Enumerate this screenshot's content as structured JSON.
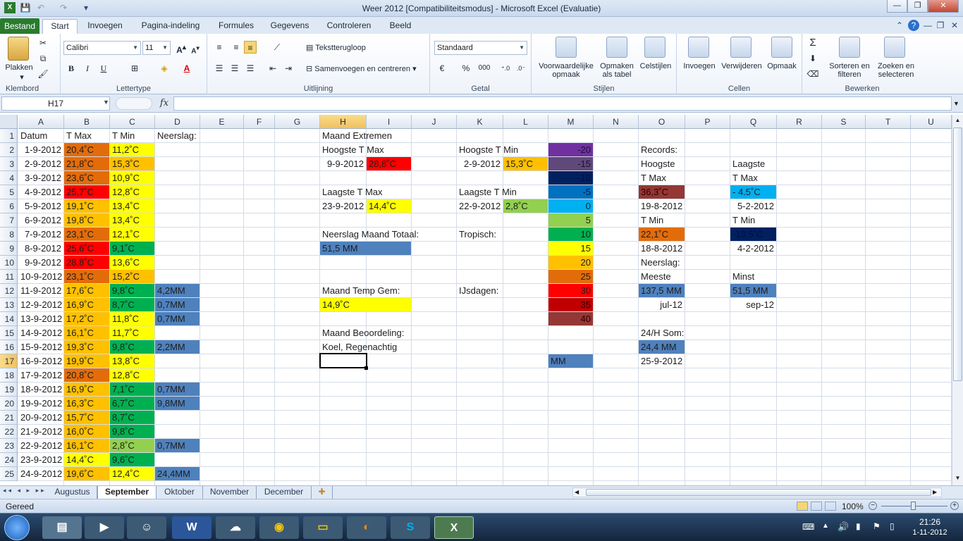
{
  "window": {
    "title": "Weer 2012  [Compatibiliteitsmodus]  -  Microsoft Excel (Evaluatie)",
    "minimize": "—",
    "restore": "❐",
    "close": "✕"
  },
  "ribbon_tabs": [
    "Bestand",
    "Start",
    "Invoegen",
    "Pagina-indeling",
    "Formules",
    "Gegevens",
    "Controleren",
    "Beeld"
  ],
  "ribbon": {
    "klembord": {
      "label": "Klembord",
      "plakken": "Plakken"
    },
    "lettertype": {
      "label": "Lettertype",
      "font": "Calibri",
      "size": "11",
      "bold": "B",
      "italic": "I",
      "underline": "U"
    },
    "uitlijning": {
      "label": "Uitlijning",
      "wrap": "Tekstterugloop",
      "merge": "Samenvoegen en centreren"
    },
    "getal": {
      "label": "Getal",
      "format": "Standaard",
      "percent": "%",
      "thousands": "000"
    },
    "stijlen": {
      "label": "Stijlen",
      "conditional": "Voorwaardelijke opmaak",
      "as_table": "Opmaken als tabel",
      "cell_styles": "Celstijlen"
    },
    "cellen": {
      "label": "Cellen",
      "insert": "Invoegen",
      "delete": "Verwijderen",
      "format": "Opmaak"
    },
    "bewerken": {
      "label": "Bewerken",
      "sort": "Sorteren en filteren",
      "find": "Zoeken en selecteren",
      "sigma": "Σ"
    }
  },
  "formula_bar": {
    "name_box": "H17",
    "fx": "fx",
    "value": ""
  },
  "columns": [
    "A",
    "B",
    "C",
    "D",
    "E",
    "F",
    "G",
    "H",
    "I",
    "J",
    "K",
    "L",
    "M",
    "N",
    "O",
    "P",
    "Q",
    "R",
    "S",
    "T",
    "U"
  ],
  "rows": [
    "1",
    "2",
    "3",
    "4",
    "5",
    "6",
    "7",
    "8",
    "9",
    "10",
    "11",
    "12",
    "13",
    "14",
    "15",
    "16",
    "17",
    "18",
    "19",
    "20",
    "21",
    "22",
    "23",
    "24",
    "25"
  ],
  "colors": {
    "orange_dark": "#e36c0a",
    "orange": "#ffc000",
    "red": "#ff0000",
    "yellow": "#ffff00",
    "green": "#00b050",
    "lightgreen": "#92d050",
    "blue": "#4f81bd",
    "skyblue": "#00b0f0",
    "navy": "#002060",
    "purple": "#7030a0",
    "darkred": "#c00000",
    "maroon": "#953734"
  },
  "cells": [
    {
      "r": 1,
      "c": "A",
      "v": "Datum"
    },
    {
      "r": 1,
      "c": "B",
      "v": "T Max"
    },
    {
      "r": 1,
      "c": "C",
      "v": "T Min"
    },
    {
      "r": 1,
      "c": "D",
      "v": "Neerslag:"
    },
    {
      "r": 2,
      "c": "A",
      "v": "1-9-2012",
      "a": "r"
    },
    {
      "r": 2,
      "c": "B",
      "v": "20,4˚C",
      "bg": "#e36c0a"
    },
    {
      "r": 2,
      "c": "C",
      "v": "11,2˚C",
      "bg": "#ffff00"
    },
    {
      "r": 3,
      "c": "A",
      "v": "2-9-2012",
      "a": "r"
    },
    {
      "r": 3,
      "c": "B",
      "v": "21,8˚C",
      "bg": "#e36c0a"
    },
    {
      "r": 3,
      "c": "C",
      "v": "15,3˚C",
      "bg": "#ffc000"
    },
    {
      "r": 4,
      "c": "A",
      "v": "3-9-2012",
      "a": "r"
    },
    {
      "r": 4,
      "c": "B",
      "v": "23,6˚C",
      "bg": "#e36c0a"
    },
    {
      "r": 4,
      "c": "C",
      "v": "10,9˚C",
      "bg": "#ffff00"
    },
    {
      "r": 5,
      "c": "A",
      "v": "4-9-2012",
      "a": "r"
    },
    {
      "r": 5,
      "c": "B",
      "v": "25,7˚C",
      "bg": "#ff0000"
    },
    {
      "r": 5,
      "c": "C",
      "v": "12,8˚C",
      "bg": "#ffff00"
    },
    {
      "r": 6,
      "c": "A",
      "v": "5-9-2012",
      "a": "r"
    },
    {
      "r": 6,
      "c": "B",
      "v": "19,1˚C",
      "bg": "#ffc000"
    },
    {
      "r": 6,
      "c": "C",
      "v": "13,4˚C",
      "bg": "#ffff00"
    },
    {
      "r": 7,
      "c": "A",
      "v": "6-9-2012",
      "a": "r"
    },
    {
      "r": 7,
      "c": "B",
      "v": "19,8˚C",
      "bg": "#ffc000"
    },
    {
      "r": 7,
      "c": "C",
      "v": "13,4˚C",
      "bg": "#ffff00"
    },
    {
      "r": 8,
      "c": "A",
      "v": "7-9-2012",
      "a": "r"
    },
    {
      "r": 8,
      "c": "B",
      "v": "23,1˚C",
      "bg": "#e36c0a"
    },
    {
      "r": 8,
      "c": "C",
      "v": "12,1˚C",
      "bg": "#ffff00"
    },
    {
      "r": 9,
      "c": "A",
      "v": "8-9-2012",
      "a": "r"
    },
    {
      "r": 9,
      "c": "B",
      "v": "25,6˚C",
      "bg": "#ff0000"
    },
    {
      "r": 9,
      "c": "C",
      "v": "9,1˚C",
      "bg": "#00b050"
    },
    {
      "r": 10,
      "c": "A",
      "v": "9-9-2012",
      "a": "r"
    },
    {
      "r": 10,
      "c": "B",
      "v": "28,8˚C",
      "bg": "#ff0000"
    },
    {
      "r": 10,
      "c": "C",
      "v": "13,6˚C",
      "bg": "#ffff00"
    },
    {
      "r": 11,
      "c": "A",
      "v": "10-9-2012",
      "a": "r"
    },
    {
      "r": 11,
      "c": "B",
      "v": "23,1˚C",
      "bg": "#e36c0a"
    },
    {
      "r": 11,
      "c": "C",
      "v": "15,2˚C",
      "bg": "#ffc000"
    },
    {
      "r": 12,
      "c": "A",
      "v": "11-9-2012",
      "a": "r"
    },
    {
      "r": 12,
      "c": "B",
      "v": "17,6˚C",
      "bg": "#ffc000"
    },
    {
      "r": 12,
      "c": "C",
      "v": "9,8˚C",
      "bg": "#00b050"
    },
    {
      "r": 12,
      "c": "D",
      "v": "4,2MM",
      "bg": "#4f81bd"
    },
    {
      "r": 13,
      "c": "A",
      "v": "12-9-2012",
      "a": "r"
    },
    {
      "r": 13,
      "c": "B",
      "v": "16,9˚C",
      "bg": "#ffc000"
    },
    {
      "r": 13,
      "c": "C",
      "v": "8,7˚C",
      "bg": "#00b050"
    },
    {
      "r": 13,
      "c": "D",
      "v": "0,7MM",
      "bg": "#4f81bd"
    },
    {
      "r": 14,
      "c": "A",
      "v": "13-9-2012",
      "a": "r"
    },
    {
      "r": 14,
      "c": "B",
      "v": "17,2˚C",
      "bg": "#ffc000"
    },
    {
      "r": 14,
      "c": "C",
      "v": "11,8˚C",
      "bg": "#ffff00"
    },
    {
      "r": 14,
      "c": "D",
      "v": "0,7MM",
      "bg": "#4f81bd"
    },
    {
      "r": 15,
      "c": "A",
      "v": "14-9-2012",
      "a": "r"
    },
    {
      "r": 15,
      "c": "B",
      "v": "16,1˚C",
      "bg": "#ffc000"
    },
    {
      "r": 15,
      "c": "C",
      "v": "11,7˚C",
      "bg": "#ffff00"
    },
    {
      "r": 16,
      "c": "A",
      "v": "15-9-2012",
      "a": "r"
    },
    {
      "r": 16,
      "c": "B",
      "v": "19,3˚C",
      "bg": "#ffc000"
    },
    {
      "r": 16,
      "c": "C",
      "v": "9,8˚C",
      "bg": "#00b050"
    },
    {
      "r": 16,
      "c": "D",
      "v": "2,2MM",
      "bg": "#4f81bd"
    },
    {
      "r": 17,
      "c": "A",
      "v": "16-9-2012",
      "a": "r"
    },
    {
      "r": 17,
      "c": "B",
      "v": "19,9˚C",
      "bg": "#ffc000"
    },
    {
      "r": 17,
      "c": "C",
      "v": "13,8˚C",
      "bg": "#ffff00"
    },
    {
      "r": 18,
      "c": "A",
      "v": "17-9-2012",
      "a": "r"
    },
    {
      "r": 18,
      "c": "B",
      "v": "20,8˚C",
      "bg": "#e36c0a"
    },
    {
      "r": 18,
      "c": "C",
      "v": "12,8˚C",
      "bg": "#ffff00"
    },
    {
      "r": 19,
      "c": "A",
      "v": "18-9-2012",
      "a": "r"
    },
    {
      "r": 19,
      "c": "B",
      "v": "16,9˚C",
      "bg": "#ffc000"
    },
    {
      "r": 19,
      "c": "C",
      "v": "7,1˚C",
      "bg": "#00b050"
    },
    {
      "r": 19,
      "c": "D",
      "v": "0,7MM",
      "bg": "#4f81bd"
    },
    {
      "r": 20,
      "c": "A",
      "v": "19-9-2012",
      "a": "r"
    },
    {
      "r": 20,
      "c": "B",
      "v": "16,3˚C",
      "bg": "#ffc000"
    },
    {
      "r": 20,
      "c": "C",
      "v": "6,7˚C",
      "bg": "#00b050"
    },
    {
      "r": 20,
      "c": "D",
      "v": "9,8MM",
      "bg": "#4f81bd"
    },
    {
      "r": 21,
      "c": "A",
      "v": "20-9-2012",
      "a": "r"
    },
    {
      "r": 21,
      "c": "B",
      "v": "15,7˚C",
      "bg": "#ffc000"
    },
    {
      "r": 21,
      "c": "C",
      "v": "8,7˚C",
      "bg": "#00b050"
    },
    {
      "r": 22,
      "c": "A",
      "v": "21-9-2012",
      "a": "r"
    },
    {
      "r": 22,
      "c": "B",
      "v": "16,0˚C",
      "bg": "#ffc000"
    },
    {
      "r": 22,
      "c": "C",
      "v": "9,8˚C",
      "bg": "#00b050"
    },
    {
      "r": 23,
      "c": "A",
      "v": "22-9-2012",
      "a": "r"
    },
    {
      "r": 23,
      "c": "B",
      "v": "16,1˚C",
      "bg": "#ffc000"
    },
    {
      "r": 23,
      "c": "C",
      "v": "2,8˚C",
      "bg": "#92d050"
    },
    {
      "r": 23,
      "c": "D",
      "v": "0,7MM",
      "bg": "#4f81bd"
    },
    {
      "r": 24,
      "c": "A",
      "v": "23-9-2012",
      "a": "r"
    },
    {
      "r": 24,
      "c": "B",
      "v": "14,4˚C",
      "bg": "#ffff00"
    },
    {
      "r": 24,
      "c": "C",
      "v": "9,6˚C",
      "bg": "#00b050"
    },
    {
      "r": 25,
      "c": "A",
      "v": "24-9-2012",
      "a": "r"
    },
    {
      "r": 25,
      "c": "B",
      "v": "19,6˚C",
      "bg": "#ffc000"
    },
    {
      "r": 25,
      "c": "C",
      "v": "12,4˚C",
      "bg": "#ffff00"
    },
    {
      "r": 25,
      "c": "D",
      "v": "24,4MM",
      "bg": "#4f81bd"
    },
    {
      "r": 1,
      "c": "H",
      "v": "Maand Extremen"
    },
    {
      "r": 2,
      "c": "H",
      "v": "Hoogste T Max"
    },
    {
      "r": 2,
      "c": "K",
      "v": "Hoogste T Min"
    },
    {
      "r": 3,
      "c": "H",
      "v": "9-9-2012",
      "a": "r"
    },
    {
      "r": 3,
      "c": "I",
      "v": "28,8˚C",
      "bg": "#ff0000"
    },
    {
      "r": 3,
      "c": "K",
      "v": "2-9-2012",
      "a": "r"
    },
    {
      "r": 3,
      "c": "L",
      "v": "15,3˚C",
      "bg": "#ffc000"
    },
    {
      "r": 5,
      "c": "H",
      "v": "Laagste T Max"
    },
    {
      "r": 5,
      "c": "K",
      "v": "Laagste T Min"
    },
    {
      "r": 6,
      "c": "H",
      "v": "23-9-2012",
      "a": "r"
    },
    {
      "r": 6,
      "c": "I",
      "v": "14,4˚C",
      "bg": "#ffff00"
    },
    {
      "r": 6,
      "c": "K",
      "v": "22-9-2012",
      "a": "r"
    },
    {
      "r": 6,
      "c": "L",
      "v": "2,8˚C",
      "bg": "#92d050"
    },
    {
      "r": 8,
      "c": "H",
      "v": "Neerslag Maand Totaal:"
    },
    {
      "r": 8,
      "c": "K",
      "v": "Tropisch:"
    },
    {
      "r": 9,
      "c": "H",
      "v": "51,5 MM",
      "bg": "#4f81bd",
      "span": 2
    },
    {
      "r": 12,
      "c": "H",
      "v": "Maand Temp Gem:"
    },
    {
      "r": 12,
      "c": "K",
      "v": "IJsdagen:"
    },
    {
      "r": 13,
      "c": "H",
      "v": "14,9˚C",
      "bg": "#ffff00",
      "span": 2
    },
    {
      "r": 15,
      "c": "H",
      "v": "Maand Beoordeling:"
    },
    {
      "r": 16,
      "c": "H",
      "v": "Koel, Regenachtig"
    },
    {
      "r": 2,
      "c": "M",
      "v": "-20",
      "bg": "#7030a0",
      "a": "r"
    },
    {
      "r": 3,
      "c": "M",
      "v": "-15",
      "bg": "#5f497a",
      "a": "r"
    },
    {
      "r": 4,
      "c": "M",
      "v": "-10",
      "bg": "#002060",
      "a": "r"
    },
    {
      "r": 5,
      "c": "M",
      "v": "-5",
      "bg": "#0070c0",
      "a": "r"
    },
    {
      "r": 6,
      "c": "M",
      "v": "0",
      "bg": "#00b0f0",
      "a": "r"
    },
    {
      "r": 7,
      "c": "M",
      "v": "5",
      "bg": "#92d050",
      "a": "r"
    },
    {
      "r": 8,
      "c": "M",
      "v": "10",
      "bg": "#00b050",
      "a": "r"
    },
    {
      "r": 9,
      "c": "M",
      "v": "15",
      "bg": "#ffff00",
      "a": "r"
    },
    {
      "r": 10,
      "c": "M",
      "v": "20",
      "bg": "#ffc000",
      "a": "r"
    },
    {
      "r": 11,
      "c": "M",
      "v": "25",
      "bg": "#e36c0a",
      "a": "r"
    },
    {
      "r": 12,
      "c": "M",
      "v": "30",
      "bg": "#ff0000",
      "a": "r"
    },
    {
      "r": 13,
      "c": "M",
      "v": "35",
      "bg": "#c00000",
      "a": "r"
    },
    {
      "r": 14,
      "c": "M",
      "v": "40",
      "bg": "#953734",
      "a": "r"
    },
    {
      "r": 17,
      "c": "M",
      "v": "MM",
      "bg": "#4f81bd"
    },
    {
      "r": 2,
      "c": "O",
      "v": "Records:"
    },
    {
      "r": 3,
      "c": "O",
      "v": "Hoogste"
    },
    {
      "r": 3,
      "c": "Q",
      "v": "Laagste"
    },
    {
      "r": 4,
      "c": "O",
      "v": "T Max"
    },
    {
      "r": 4,
      "c": "Q",
      "v": "T Max"
    },
    {
      "r": 5,
      "c": "O",
      "v": "36,3˚C",
      "bg": "#953734"
    },
    {
      "r": 5,
      "c": "Q",
      "v": "- 4.5˚C",
      "bg": "#00b0f0"
    },
    {
      "r": 6,
      "c": "O",
      "v": "19-8-2012",
      "a": "r"
    },
    {
      "r": 6,
      "c": "Q",
      "v": "5-2-2012",
      "a": "r"
    },
    {
      "r": 7,
      "c": "O",
      "v": "T Min"
    },
    {
      "r": 7,
      "c": "Q",
      "v": "T Min"
    },
    {
      "r": 8,
      "c": "O",
      "v": "22,1˚C",
      "bg": "#e36c0a"
    },
    {
      "r": 8,
      "c": "Q",
      "v": "-13,5˚C",
      "bg": "#002060"
    },
    {
      "r": 9,
      "c": "O",
      "v": "18-8-2012",
      "a": "r"
    },
    {
      "r": 9,
      "c": "Q",
      "v": "4-2-2012",
      "a": "r"
    },
    {
      "r": 10,
      "c": "O",
      "v": "Neerslag:"
    },
    {
      "r": 11,
      "c": "O",
      "v": "Meeste"
    },
    {
      "r": 11,
      "c": "Q",
      "v": "Minst"
    },
    {
      "r": 12,
      "c": "O",
      "v": "137,5 MM",
      "bg": "#4f81bd"
    },
    {
      "r": 12,
      "c": "Q",
      "v": "51,5 MM",
      "bg": "#4f81bd"
    },
    {
      "r": 13,
      "c": "O",
      "v": "jul-12",
      "a": "r"
    },
    {
      "r": 13,
      "c": "Q",
      "v": "sep-12",
      "a": "r"
    },
    {
      "r": 15,
      "c": "O",
      "v": "24/H Som:"
    },
    {
      "r": 16,
      "c": "O",
      "v": "24,4 MM",
      "bg": "#4f81bd"
    },
    {
      "r": 17,
      "c": "O",
      "v": "25-9-2012",
      "a": "r"
    }
  ],
  "selected": {
    "col": "H",
    "row": 17
  },
  "sheets": [
    "Augustus",
    "September",
    "Oktober",
    "November",
    "December"
  ],
  "active_sheet": "September",
  "status": {
    "mode": "Gereed",
    "zoom": "100%"
  },
  "taskbar": {
    "time": "21:26",
    "date": "1-11-2012"
  }
}
